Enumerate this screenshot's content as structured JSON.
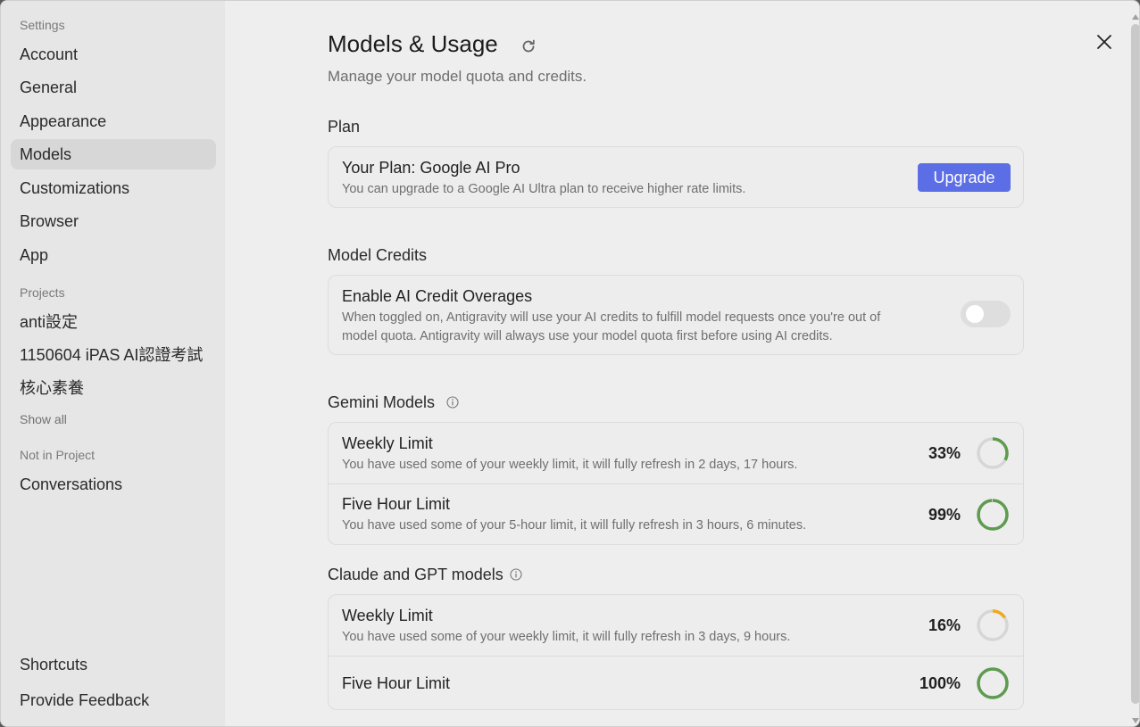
{
  "sidebar": {
    "settings_header": "Settings",
    "items": [
      {
        "label": "Account"
      },
      {
        "label": "General"
      },
      {
        "label": "Appearance"
      },
      {
        "label": "Models"
      },
      {
        "label": "Customizations"
      },
      {
        "label": "Browser"
      },
      {
        "label": "App"
      }
    ],
    "projects_header": "Projects",
    "projects": [
      {
        "label": "anti設定"
      },
      {
        "label": "1150604 iPAS AI認證考試"
      },
      {
        "label": "核心素養"
      }
    ],
    "show_all": "Show all",
    "not_in_project_header": "Not in Project",
    "conversations": "Conversations",
    "shortcuts": "Shortcuts",
    "feedback": "Provide Feedback"
  },
  "main": {
    "title": "Models & Usage",
    "subtitle": "Manage your model quota and credits.",
    "plan": {
      "section": "Plan",
      "title": "Your Plan: Google AI Pro",
      "desc": "You can upgrade to a Google AI Ultra plan to receive higher rate limits.",
      "button": "Upgrade"
    },
    "credits": {
      "section": "Model Credits",
      "title": "Enable AI Credit Overages",
      "desc_line1": "When toggled on, Antigravity will use your AI credits to fulfill model requests once you're out of",
      "desc_line2": "model quota. Antigravity will always use your model quota first before using AI credits.",
      "toggle_on": false
    },
    "gemini": {
      "section": "Gemini Models",
      "weekly": {
        "title": "Weekly Limit",
        "desc": "You have used some of your weekly limit, it will fully refresh in 2 days, 17 hours.",
        "percent_label": "33%",
        "fraction": 0.33,
        "color": "#5e9b4f"
      },
      "five_hour": {
        "title": "Five Hour Limit",
        "desc": "You have used some of your 5-hour limit, it will fully refresh in 3 hours, 6 minutes.",
        "percent_label": "99%",
        "fraction": 0.99,
        "color": "#5e9b4f"
      }
    },
    "claude_gpt": {
      "section": "Claude and GPT models",
      "weekly": {
        "title": "Weekly Limit",
        "desc": "You have used some of your weekly limit, it will fully refresh in 3 days, 9 hours.",
        "percent_label": "16%",
        "fraction": 0.16,
        "color": "#f0a91e"
      },
      "five_hour": {
        "title": "Five Hour Limit",
        "percent_label": "100%",
        "fraction": 1.0,
        "color": "#5e9b4f"
      }
    }
  },
  "icons": {
    "refresh": "refresh-icon",
    "close": "close-icon",
    "info": "info-icon"
  },
  "colors": {
    "accent": "#5b6ee6",
    "ring_track": "#d6d6d6"
  }
}
